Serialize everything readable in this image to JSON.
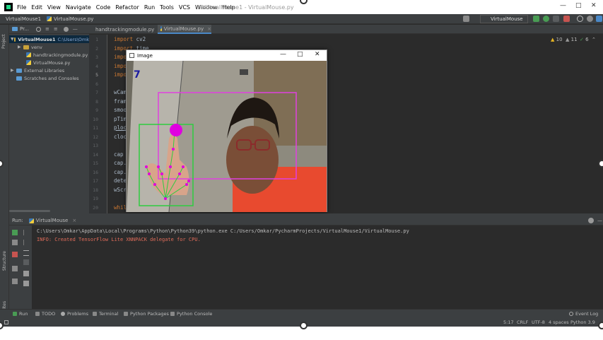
{
  "menu": {
    "items": [
      "File",
      "Edit",
      "View",
      "Navigate",
      "Code",
      "Refactor",
      "Run",
      "Tools",
      "VCS",
      "Window",
      "Help"
    ],
    "window_title": "VirtualMouse1 - VirtualMouse.py"
  },
  "navbar": {
    "project": "VirtualMouse1",
    "file": "VirtualMouse.py",
    "run_config": "VirtualMouse"
  },
  "project_pane": {
    "header": "Pr...",
    "tree": [
      {
        "label": "VirtualMouse1",
        "extra": "C:\\Users\\Omk",
        "type": "folder"
      },
      {
        "label": "venv",
        "type": "folder"
      },
      {
        "label": "handtrackingmodule.py",
        "type": "py"
      },
      {
        "label": "VirtualMouse.py",
        "type": "py"
      },
      {
        "label": "External Libraries",
        "type": "lib"
      },
      {
        "label": "Scratches and Consoles",
        "type": "lib"
      }
    ]
  },
  "editor": {
    "tabs": [
      "handtrackingmodule.py",
      "VirtualMouse.py"
    ],
    "line_numbers": [
      "1",
      "2",
      "3",
      "4",
      "5",
      "6",
      "7",
      "8",
      "9",
      "10",
      "11",
      "12",
      "13",
      "14",
      "15",
      "16",
      "17",
      "18",
      "19",
      "20"
    ],
    "current_line": "5",
    "code_lines": [
      {
        "kw": "import",
        "rest": " cv2"
      },
      {
        "kw": "import",
        "rest": " time"
      },
      {
        "kw": "impo",
        "rest": ""
      },
      {
        "kw": "impo",
        "rest": ""
      },
      {
        "kw": "impo",
        "rest": ""
      },
      {
        "kw": "",
        "rest": ""
      },
      {
        "kw": "",
        "rest": "wCam"
      },
      {
        "kw": "",
        "rest": "fram"
      },
      {
        "kw": "",
        "rest": "smoo"
      },
      {
        "kw": "",
        "rest": "pTim"
      },
      {
        "kw": "",
        "rest": "ploc"
      },
      {
        "kw": "",
        "rest": "cloc"
      },
      {
        "kw": "",
        "rest": ""
      },
      {
        "kw": "",
        "rest": "cap "
      },
      {
        "kw": "",
        "rest": "cap."
      },
      {
        "kw": "",
        "rest": "cap."
      },
      {
        "kw": "",
        "rest": "dete"
      },
      {
        "kw": "",
        "rest": "wScr"
      },
      {
        "kw": "",
        "rest": ""
      },
      {
        "kw": "whil",
        "rest": ""
      }
    ],
    "inspections": {
      "warnings": "10",
      "weak": "11",
      "ok": "6"
    }
  },
  "image_window": {
    "title": "Image",
    "fps_text": "7"
  },
  "run_panel": {
    "label": "Run:",
    "tab": "VirtualMouse",
    "console": [
      {
        "text": "C:\\Users\\Omkar\\AppData\\Local\\Programs\\Python\\Python39\\python.exe C:/Users/Omkar/PycharmProjects/VirtualMouse1/VirtualMouse.py",
        "color": "#bbbbbb"
      },
      {
        "text": "INFO: Created TensorFlow Lite XNNPACK delegate for CPU.",
        "color": "#e06c5a"
      }
    ]
  },
  "tool_windows": [
    "Run",
    "TODO",
    "Problems",
    "Terminal",
    "Python Packages",
    "Python Console"
  ],
  "event_log": "Event Log",
  "status": {
    "position": "5:17",
    "line_sep": "CRLF",
    "encoding": "UTF-8",
    "indent": "4 spaces",
    "interpreter": "Python 3.9"
  },
  "side_labels": {
    "project": "Project",
    "structure": "Structure",
    "favorites": "Favorites"
  },
  "colors": {
    "accent": "#4a88c7",
    "landmark": "#e000e0",
    "hand_box": "#2ecc40",
    "face_box": "#e040e0"
  }
}
